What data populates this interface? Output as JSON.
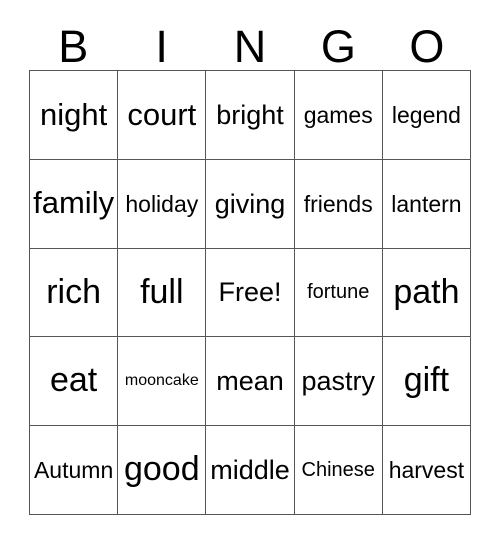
{
  "card": {
    "title_letters": [
      "B",
      "I",
      "N",
      "G",
      "O"
    ],
    "grid_border_color": "#555555",
    "text_color": "#000000",
    "background_color": "#ffffff",
    "rows": [
      [
        {
          "text": "night",
          "size": "lg"
        },
        {
          "text": "court",
          "size": "lg"
        },
        {
          "text": "bright",
          "size": "md"
        },
        {
          "text": "games",
          "size": "sm"
        },
        {
          "text": "legend",
          "size": "sm"
        }
      ],
      [
        {
          "text": "family",
          "size": "lg"
        },
        {
          "text": "holiday",
          "size": "sm"
        },
        {
          "text": "giving",
          "size": "md"
        },
        {
          "text": "friends",
          "size": "sm"
        },
        {
          "text": "lantern",
          "size": "sm"
        }
      ],
      [
        {
          "text": "rich",
          "size": "xl"
        },
        {
          "text": "full",
          "size": "xl"
        },
        {
          "text": "Free!",
          "size": "md"
        },
        {
          "text": "fortune",
          "size": "xs"
        },
        {
          "text": "path",
          "size": "xl"
        }
      ],
      [
        {
          "text": "eat",
          "size": "xl"
        },
        {
          "text": "mooncake",
          "size": "xxs"
        },
        {
          "text": "mean",
          "size": "md"
        },
        {
          "text": "pastry",
          "size": "md"
        },
        {
          "text": "gift",
          "size": "xl"
        }
      ],
      [
        {
          "text": "Autumn",
          "size": "sm"
        },
        {
          "text": "good",
          "size": "xl"
        },
        {
          "text": "middle",
          "size": "md"
        },
        {
          "text": "Chinese",
          "size": "xs"
        },
        {
          "text": "harvest",
          "size": "sm"
        }
      ]
    ]
  }
}
